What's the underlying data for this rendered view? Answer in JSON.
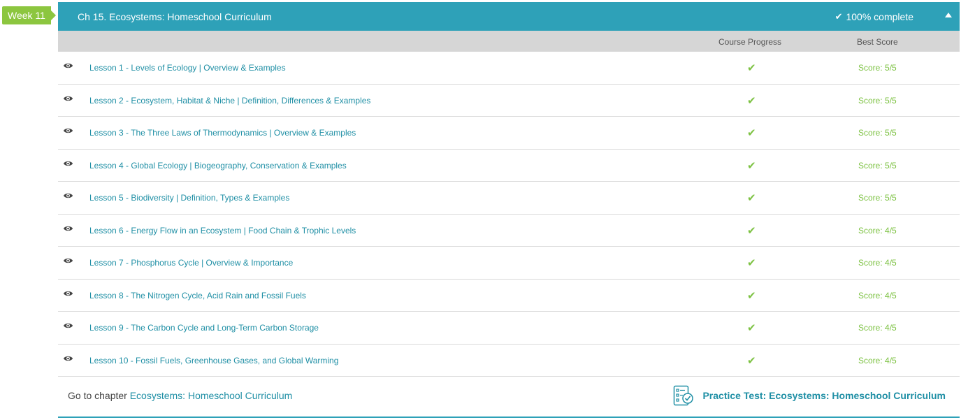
{
  "week_tag": "Week 11",
  "chapter": {
    "title": "Ch 15. Ecosystems: Homeschool Curriculum",
    "complete_label": "100% complete",
    "colors": {
      "header": "#2ea1b8",
      "accent": "#7dc243",
      "link": "#1f8fa5"
    }
  },
  "columns": {
    "progress": "Course Progress",
    "score": "Best Score"
  },
  "lessons": [
    {
      "title": "Lesson 1 - Levels of Ecology | Overview & Examples",
      "progress": "complete",
      "score": "Score: 5/5"
    },
    {
      "title": "Lesson 2 - Ecosystem, Habitat & Niche | Definition, Differences & Examples",
      "progress": "complete",
      "score": "Score: 5/5"
    },
    {
      "title": "Lesson 3 - The Three Laws of Thermodynamics | Overview & Examples",
      "progress": "complete",
      "score": "Score: 5/5"
    },
    {
      "title": "Lesson 4 - Global Ecology | Biogeography, Conservation & Examples",
      "progress": "complete",
      "score": "Score: 5/5"
    },
    {
      "title": "Lesson 5 - Biodiversity | Definition, Types & Examples",
      "progress": "complete",
      "score": "Score: 5/5"
    },
    {
      "title": "Lesson 6 - Energy Flow in an Ecosystem | Food Chain & Trophic Levels",
      "progress": "complete",
      "score": "Score: 4/5"
    },
    {
      "title": "Lesson 7 - Phosphorus Cycle | Overview & Importance",
      "progress": "complete",
      "score": "Score: 4/5"
    },
    {
      "title": "Lesson 8 - The Nitrogen Cycle, Acid Rain and Fossil Fuels",
      "progress": "complete",
      "score": "Score: 4/5"
    },
    {
      "title": "Lesson 9 - The Carbon Cycle and Long-Term Carbon Storage",
      "progress": "complete",
      "score": "Score: 4/5"
    },
    {
      "title": "Lesson 10 - Fossil Fuels, Greenhouse Gases, and Global Warming",
      "progress": "complete",
      "score": "Score: 4/5"
    }
  ],
  "footer": {
    "goto_prefix": "Go to chapter",
    "goto_link": "Ecosystems: Homeschool Curriculum",
    "practice_label": "Practice Test: Ecosystems: Homeschool Curriculum",
    "practice_icon": "checklist-icon"
  }
}
